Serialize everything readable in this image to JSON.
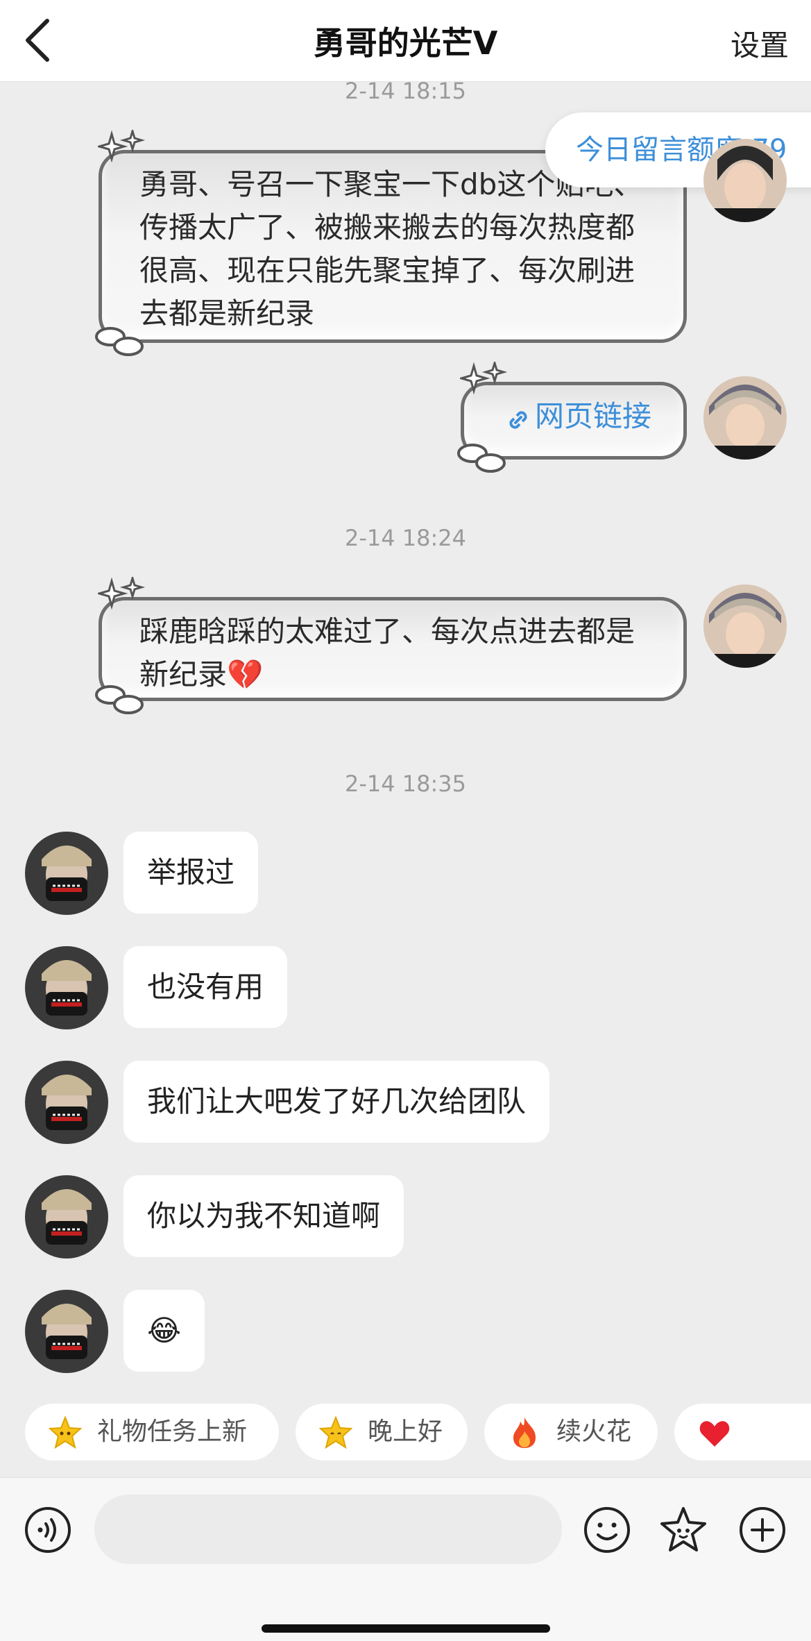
{
  "header": {
    "title": "勇哥的光芒Ⅴ",
    "settings_label": "设置"
  },
  "quota": {
    "text": "今日留言额度:79"
  },
  "messages": {
    "ts1": "2-14 18:15",
    "m1": "勇哥、号召一下聚宝一下db这个贴吧、传播太广了、被搬来搬去的每次热度都很高、现在只能先聚宝掉了、每次刷进去都是新纪录",
    "m2_link": "网页链接",
    "ts2": "2-14 18:24",
    "m3_text": "踩鹿晗踩的太难过了、每次点进去都是新纪录",
    "m3_emoji": "💔",
    "ts3": "2-14 18:35",
    "r1": "举报过",
    "r2": "也没有用",
    "r3": "我们让大吧发了好几次给团队",
    "r4": "你以为我不知道啊",
    "r5": "😂"
  },
  "quick_replies": [
    {
      "label": "礼物任务上新",
      "icon": "star-face-icon"
    },
    {
      "label": "晚上好",
      "icon": "star-face-icon"
    },
    {
      "label": "续火花",
      "icon": "flame-icon"
    },
    {
      "label": "",
      "icon": "heart-icon"
    }
  ],
  "input": {
    "placeholder": ""
  },
  "colors": {
    "accent": "#3d8fd9",
    "background": "#ededed",
    "bubble": "#ffffff"
  }
}
